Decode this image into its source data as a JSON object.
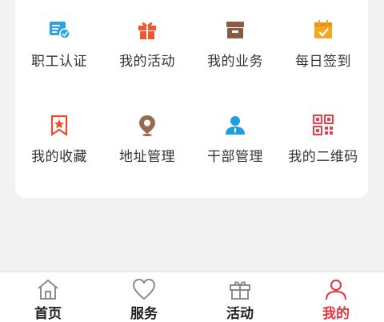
{
  "grid": {
    "items": [
      {
        "label": "职工认证",
        "icon": "employee-certification-icon",
        "color": "#29a3e8"
      },
      {
        "label": "我的活动",
        "icon": "gift-icon",
        "color": "#f2572b"
      },
      {
        "label": "我的业务",
        "icon": "archive-box-icon",
        "color": "#8a5a44"
      },
      {
        "label": "每日签到",
        "icon": "calendar-check-icon",
        "color": "#f5a623"
      },
      {
        "label": "我的收藏",
        "icon": "bookmark-star-icon",
        "color": "#ee4b2b"
      },
      {
        "label": "地址管理",
        "icon": "location-pin-icon",
        "color": "#9a6a50"
      },
      {
        "label": "干部管理",
        "icon": "user-manager-icon",
        "color": "#1e9de0"
      },
      {
        "label": "我的二维码",
        "icon": "qr-code-icon",
        "color": "#ee3d4b"
      }
    ]
  },
  "tabbar": {
    "tabs": [
      {
        "label": "首页",
        "icon": "home-icon",
        "active": false
      },
      {
        "label": "服务",
        "icon": "heart-icon",
        "active": false
      },
      {
        "label": "活动",
        "icon": "gift-box-icon",
        "active": false
      },
      {
        "label": "我的",
        "icon": "person-icon",
        "active": true
      }
    ],
    "active_color": "#e8343f"
  }
}
